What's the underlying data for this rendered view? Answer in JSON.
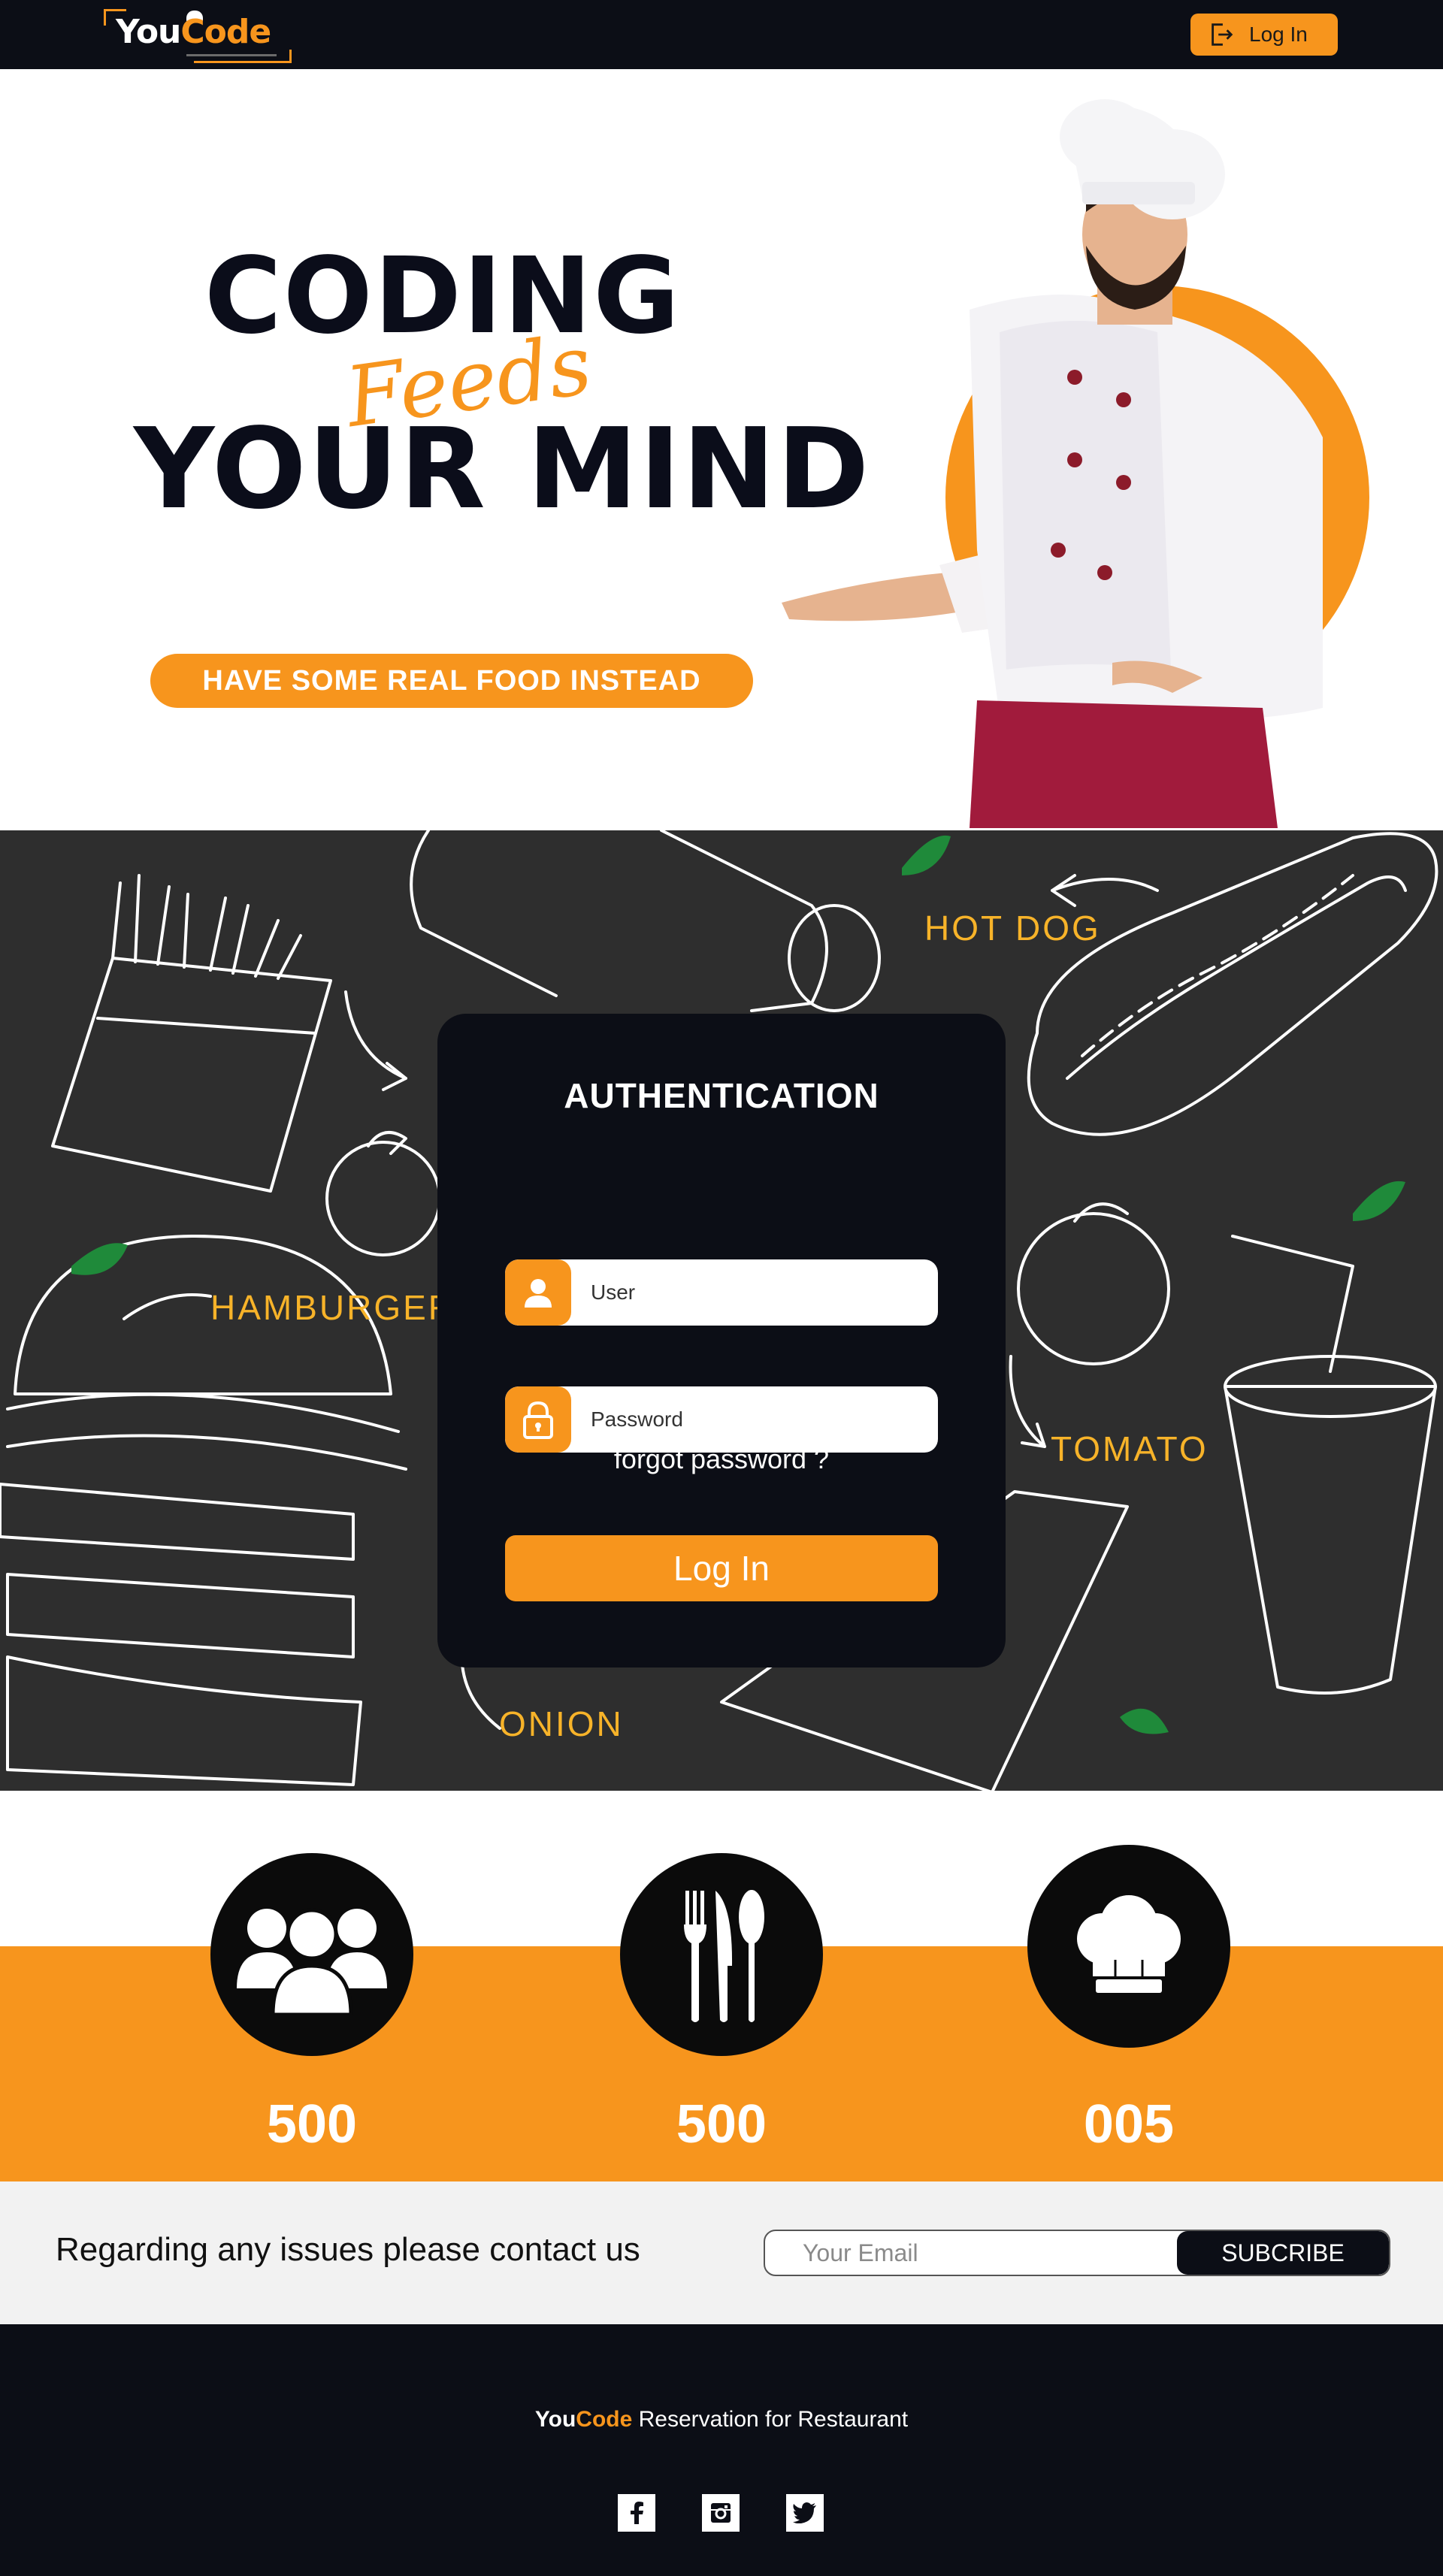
{
  "brand": {
    "you": "You",
    "code": "Code"
  },
  "navbar": {
    "login_label": "Log In",
    "login_icon": "logout-icon"
  },
  "hero": {
    "line1": "CODING",
    "script": "Feeds",
    "line2": "YOUR MIND",
    "tagline": "HAVE SOME REAL FOOD INSTEAD"
  },
  "doodle_labels": {
    "hot_dog": "HOT DOG",
    "hamburger": "HAMBURGER",
    "tomato": "TOMATO",
    "onion": "ONION"
  },
  "auth": {
    "title": "AUTHENTICATION",
    "user_placeholder": "User",
    "password_placeholder": "Password",
    "forgot": "forgot password ?",
    "login_label": "Log In"
  },
  "stats": [
    {
      "icon": "group-icon",
      "value": "500"
    },
    {
      "icon": "cutlery-icon",
      "value": "500"
    },
    {
      "icon": "chef-hat-icon",
      "value": "005"
    }
  ],
  "contact": {
    "text": "Regarding any issues please contact us",
    "email_placeholder": "Your Email",
    "subscribe_label": "SUBCRIBE"
  },
  "footer": {
    "brand_you": "You",
    "brand_code": "Code",
    "tagline": " Reservation for Restaurant",
    "socials": [
      "facebook-icon",
      "instagram-icon",
      "twitter-icon"
    ]
  },
  "colors": {
    "accent": "#f7951d",
    "dark": "#0c0e16",
    "chalkboard": "#2e2e2e",
    "label_yellow": "#f7b329"
  }
}
